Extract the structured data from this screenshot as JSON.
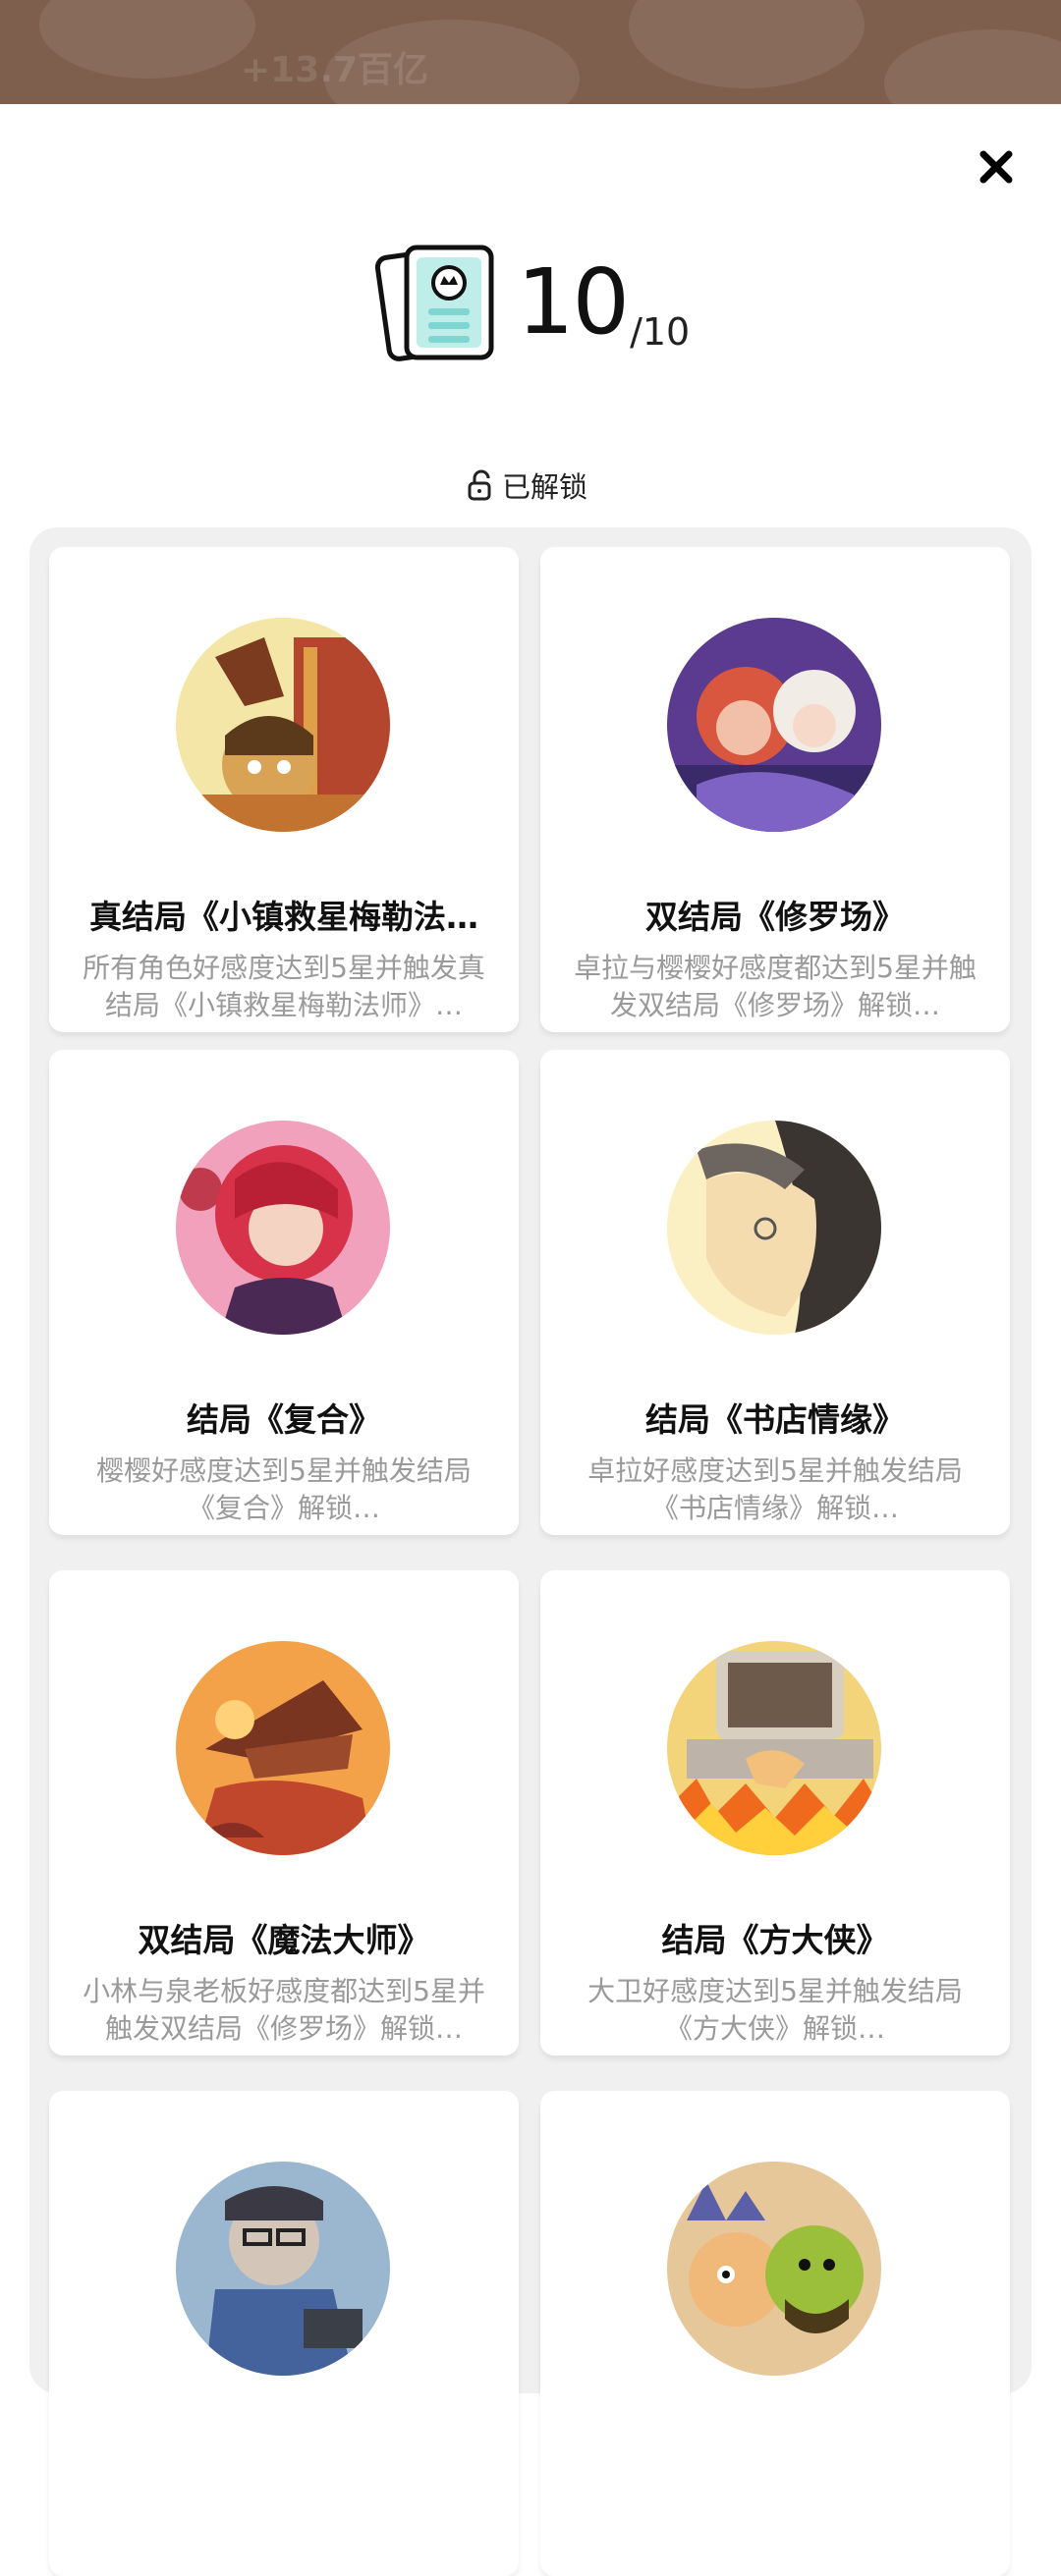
{
  "top_bar": {
    "ghost_text": "+13.7百亿"
  },
  "counter": {
    "current": "10",
    "total": "/10"
  },
  "section": {
    "unlocked_label": "已解锁"
  },
  "cards": [
    {
      "title": "真结局《小镇救星梅勒法…",
      "desc": "所有角色好感度达到5星并触发真结局《小镇救星梅勒法师》…",
      "avatar": "portrait-witch-in-doorway"
    },
    {
      "title": "双结局《修罗场》",
      "desc": "卓拉与樱樱好感度都达到5星并触发双结局《修罗场》解锁…",
      "avatar": "portrait-two-characters-purple"
    },
    {
      "title": "结局《复合》",
      "desc": "樱樱好感度达到5星并触发结局《复合》解锁…",
      "avatar": "portrait-red-hair-woman"
    },
    {
      "title": "结局《书店情缘》",
      "desc": "卓拉好感度达到5星并触发结局《书店情缘》解锁…",
      "avatar": "portrait-kiss-closeup"
    },
    {
      "title": "双结局《魔法大师》",
      "desc": "小林与泉老板好感度都达到5星并触发双结局《修罗场》解锁…",
      "avatar": "portrait-wizard-hat"
    },
    {
      "title": "结局《方大侠》",
      "desc": "大卫好感度达到5星并触发结局《方大侠》解锁…",
      "avatar": "portrait-laptop-flames"
    },
    {
      "title": "",
      "desc": "",
      "avatar": "portrait-man-with-briefcase"
    },
    {
      "title": "",
      "desc": "",
      "avatar": "portrait-two-men-castle"
    }
  ],
  "colors": {
    "accent_teal": "#7fd6d0",
    "top_bar_brown": "#7e5f4d",
    "panel_bg": "#f0f0f0"
  }
}
